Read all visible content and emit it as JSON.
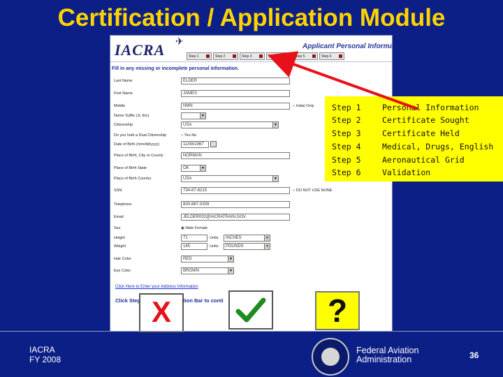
{
  "slide": {
    "title": "Certification / Application Module",
    "footer_left_line1": "IACRA",
    "footer_left_line2": "FY 2008",
    "footer_org_line1": "Federal Aviation",
    "footer_org_line2": "Administration",
    "page_number": "36"
  },
  "app": {
    "logo": "IACRA",
    "plane_glyph": "✈",
    "header_title": "Applicant Personal Information",
    "tabs": [
      "Step 1",
      "Step 2",
      "Step 3",
      "Step 4",
      "Step 5",
      "Step 6"
    ],
    "intro": "Fill in any missing or incomplete personal information.",
    "fields": {
      "last_name": {
        "label": "Last Name",
        "value": "ELDER"
      },
      "first_name": {
        "label": "First Name",
        "value": "JAMES"
      },
      "middle": {
        "label": "Middle",
        "value": "NMN",
        "extra": "Initial Only"
      },
      "suffix": {
        "label": "Name Suffix (Jr, Etc)",
        "value": ""
      },
      "citizenship": {
        "label": "Citizenship",
        "value": "USA"
      },
      "dual": {
        "label": "Do you hold a Dual Citizenship",
        "extra": "Yes   No"
      },
      "dob": {
        "label": "Date of Birth (mm/dd/yyyy)",
        "value": "11/08/1967"
      },
      "pob": {
        "label": "Place of Birth, City or County",
        "value": "NORMAN"
      },
      "pob_state": {
        "label": "Place of Birth State",
        "value": "OK"
      },
      "pob_country": {
        "label": "Place of Birth Country",
        "value": "USA"
      },
      "ssn": {
        "label": "SSN",
        "value": "734-87-8215",
        "extra": "DO NOT USE   NONE"
      },
      "telephone": {
        "label": "Telephone",
        "value": "800-867-5309"
      },
      "email": {
        "label": "Email",
        "value": "JELDER002@IACRATRAIN.GOV"
      },
      "sex": {
        "label": "Sex",
        "extra": "Male   Female"
      },
      "height": {
        "label": "Height",
        "value": "71",
        "units_label": "Units",
        "units": "INCHES"
      },
      "weight": {
        "label": "Weight",
        "value": "145",
        "units_label": "Units",
        "units": "POUNDS"
      },
      "hair": {
        "label": "Hair Color",
        "value": "RED"
      },
      "eye": {
        "label": "Eye Color",
        "value": "BROWN"
      }
    },
    "address_link": "Click Here to Enter your Address Information",
    "click_step_left": "Click Step",
    "click_step_right": "ation Bar to conti"
  },
  "steps_box": [
    {
      "step": "Step 1",
      "desc": "Personal Information"
    },
    {
      "step": "Step 2",
      "desc": "Certificate Sought"
    },
    {
      "step": "Step 3",
      "desc": "Certificate Held"
    },
    {
      "step": "Step 4",
      "desc": "Medical, Drugs, English"
    },
    {
      "step": "Step 5",
      "desc": "Aeronautical Grid"
    },
    {
      "step": "Step 6",
      "desc": "Validation"
    }
  ],
  "marks": {
    "x": "X",
    "question": "?"
  },
  "colors": {
    "background": "#0c1f86",
    "title": "#ffd400",
    "highlight": "#ffff00",
    "arrow": "#e8101a",
    "check": "#1f8a1f"
  }
}
